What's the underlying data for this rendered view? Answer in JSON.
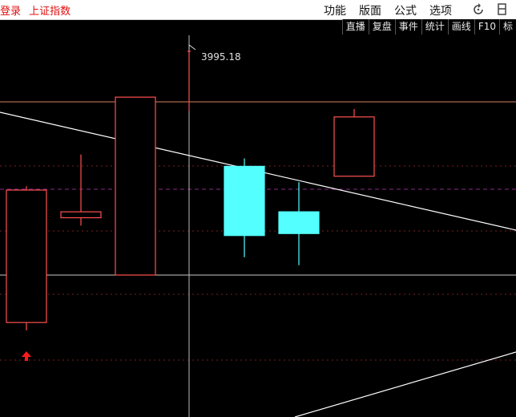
{
  "app": {
    "login_text": "登录",
    "index_name": "上证指数"
  },
  "menu": [
    {
      "label": "功能"
    },
    {
      "label": "版面"
    },
    {
      "label": "公式"
    },
    {
      "label": "选项"
    }
  ],
  "window_icons": [
    "refresh-icon",
    "restore-window-icon"
  ],
  "toolbar": [
    {
      "label": "直播"
    },
    {
      "label": "复盘"
    },
    {
      "label": "事件"
    },
    {
      "label": "统计"
    },
    {
      "label": "画线"
    },
    {
      "label": "F10"
    },
    {
      "label": "标"
    }
  ],
  "chart_data": {
    "type": "candlestick",
    "high_marker": "3995.18",
    "colors": {
      "up": "#ff5050",
      "down": "#54ffff",
      "grid": "#8a1c1c",
      "trendline": "#ffffff"
    },
    "candles": [
      {
        "open": 3858,
        "close": 3925,
        "high": 3927,
        "low": 3854,
        "color": "up"
      },
      {
        "open": 3911,
        "close": 3914,
        "high": 3943,
        "low": 3907,
        "color": "up"
      },
      {
        "open": 3882,
        "close": 3972,
        "high": 3972,
        "low": 3882,
        "color": "up"
      },
      {
        "open": 3995.18,
        "close": 3995.18,
        "high": 3995.18,
        "low": 3965,
        "color": "doji"
      },
      {
        "open": 3937,
        "close": 3902,
        "high": 3941,
        "low": 3891,
        "color": "down"
      },
      {
        "open": 3914,
        "close": 3903,
        "high": 3929,
        "low": 3887,
        "color": "down"
      },
      {
        "open": 3962,
        "close": 3932,
        "high": 3966,
        "low": 3932,
        "color": "up"
      }
    ],
    "buy_signal_candle": 0
  }
}
